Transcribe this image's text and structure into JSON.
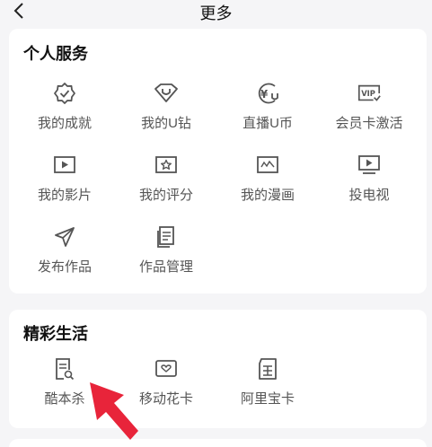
{
  "header": {
    "title": "更多",
    "back_icon": "chevron-left-icon"
  },
  "sections": [
    {
      "title": "个人服务",
      "items": [
        {
          "label": "我的成就",
          "icon": "badge-check-icon"
        },
        {
          "label": "我的U钻",
          "icon": "diamond-u-icon"
        },
        {
          "label": "直播U币",
          "icon": "yuan-coin-icon"
        },
        {
          "label": "会员卡激活",
          "icon": "vip-card-icon"
        },
        {
          "label": "我的影片",
          "icon": "play-box-icon"
        },
        {
          "label": "我的评分",
          "icon": "star-box-icon"
        },
        {
          "label": "我的漫画",
          "icon": "comic-icon"
        },
        {
          "label": "投电视",
          "icon": "tv-cast-icon"
        },
        {
          "label": "发布作品",
          "icon": "send-icon"
        },
        {
          "label": "作品管理",
          "icon": "document-stack-icon"
        }
      ]
    },
    {
      "title": "精彩生活",
      "items": [
        {
          "label": "酷本杀",
          "icon": "script-search-icon"
        },
        {
          "label": "移动花卡",
          "icon": "heart-card-icon"
        },
        {
          "label": "阿里宝卡",
          "icon": "treasure-card-icon"
        }
      ]
    }
  ],
  "colors": {
    "background": "#f5f5f7",
    "card": "#ffffff",
    "icon": "#555555",
    "annotation_arrow": "#e8243a"
  }
}
